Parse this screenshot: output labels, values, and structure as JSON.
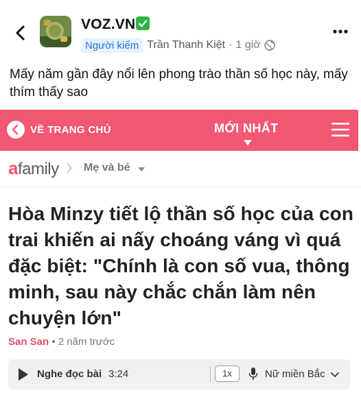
{
  "post": {
    "group_name": "VOZ.VN",
    "role_badge": "Người kiểm",
    "author": "Trần Thanh Kiệt",
    "separator": "·",
    "timestamp": "1 giờ",
    "text": "Mấy năm gần đây nổi lên phong trào thần số học này, mấy thím thấy sao"
  },
  "embed": {
    "home_label": "VỀ TRANG CHỦ",
    "latest_tab": "MỚI NHẤT",
    "brand_mark": "a",
    "brand_rest": "family",
    "breadcrumb": "Mẹ và bé",
    "article_title": "Hòa Minzy tiết lộ thần số học của con trai khiến ai nấy choáng váng vì quá đặc biệt: \"Chính là con số vua, thông minh, sau này chắc chắn làm nên chuyện lớn\"",
    "byline_author": "San San",
    "byline_time": " • 2 năm trước",
    "audio": {
      "label": "Nghe đọc bài",
      "duration": "3:24",
      "speed": "1x",
      "voice": "Nữ miền Bắc"
    }
  },
  "colors": {
    "brand_pink": "#f25773",
    "verified_green": "#2fb344",
    "role_blue": "#1b74e4"
  },
  "icons": [
    "back-arrow-icon",
    "verified-check-icon",
    "globe-icon",
    "more-dots-icon",
    "chevron-left-icon",
    "menu-icon",
    "play-icon",
    "mic-icon",
    "chevron-down-icon"
  ]
}
